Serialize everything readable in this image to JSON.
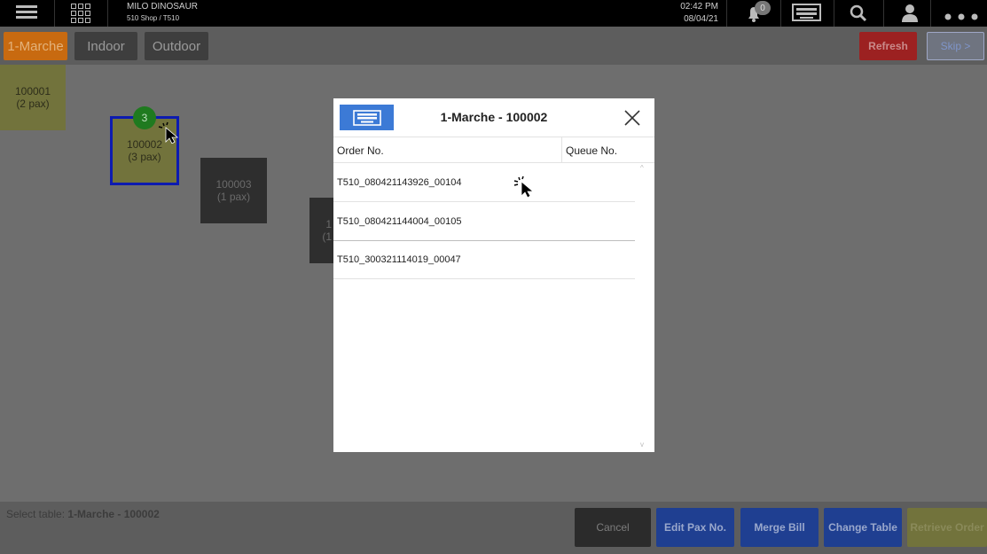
{
  "header": {
    "app_name": "MILO DINOSAUR",
    "shop": "510 Shop / T510",
    "time": "02:42 PM",
    "date": "08/04/21",
    "notification_count": "0"
  },
  "tabs": [
    {
      "label": "1-Marche"
    },
    {
      "label": "Indoor"
    },
    {
      "label": "Outdoor"
    }
  ],
  "actions": {
    "refresh": "Refresh",
    "skip": "Skip >"
  },
  "tables": [
    {
      "id": "100001",
      "pax": "(2 pax)"
    },
    {
      "id": "100002",
      "pax": "(3 pax)",
      "badge": "3"
    },
    {
      "id": "100003",
      "pax": "(1 pax)"
    },
    {
      "id": "1",
      "pax": "(1"
    }
  ],
  "footer": {
    "label": "Select table:",
    "value": "1-Marche - 100002",
    "buttons": {
      "cancel": "Cancel",
      "edit_pax": "Edit Pax No.",
      "merge_bill": "Merge Bill",
      "change_table": "Change Table",
      "retrieve_order": "Retrieve Order"
    }
  },
  "modal": {
    "title": "1-Marche - 100002",
    "columns": {
      "order": "Order No.",
      "queue": "Queue No."
    },
    "orders": [
      {
        "order_no": "T510_080421143926_00104",
        "queue_no": ""
      },
      {
        "order_no": "T510_080421144004_00105",
        "queue_no": ""
      },
      {
        "order_no": "T510_300321114019_00047",
        "queue_no": ""
      }
    ]
  },
  "colors": {
    "active_tab": "#c86a10",
    "refresh": "#9c2121",
    "primary_button": "#1f3f91",
    "selected_table_border": "#0d1bb0",
    "badge": "#1f8a1f"
  }
}
